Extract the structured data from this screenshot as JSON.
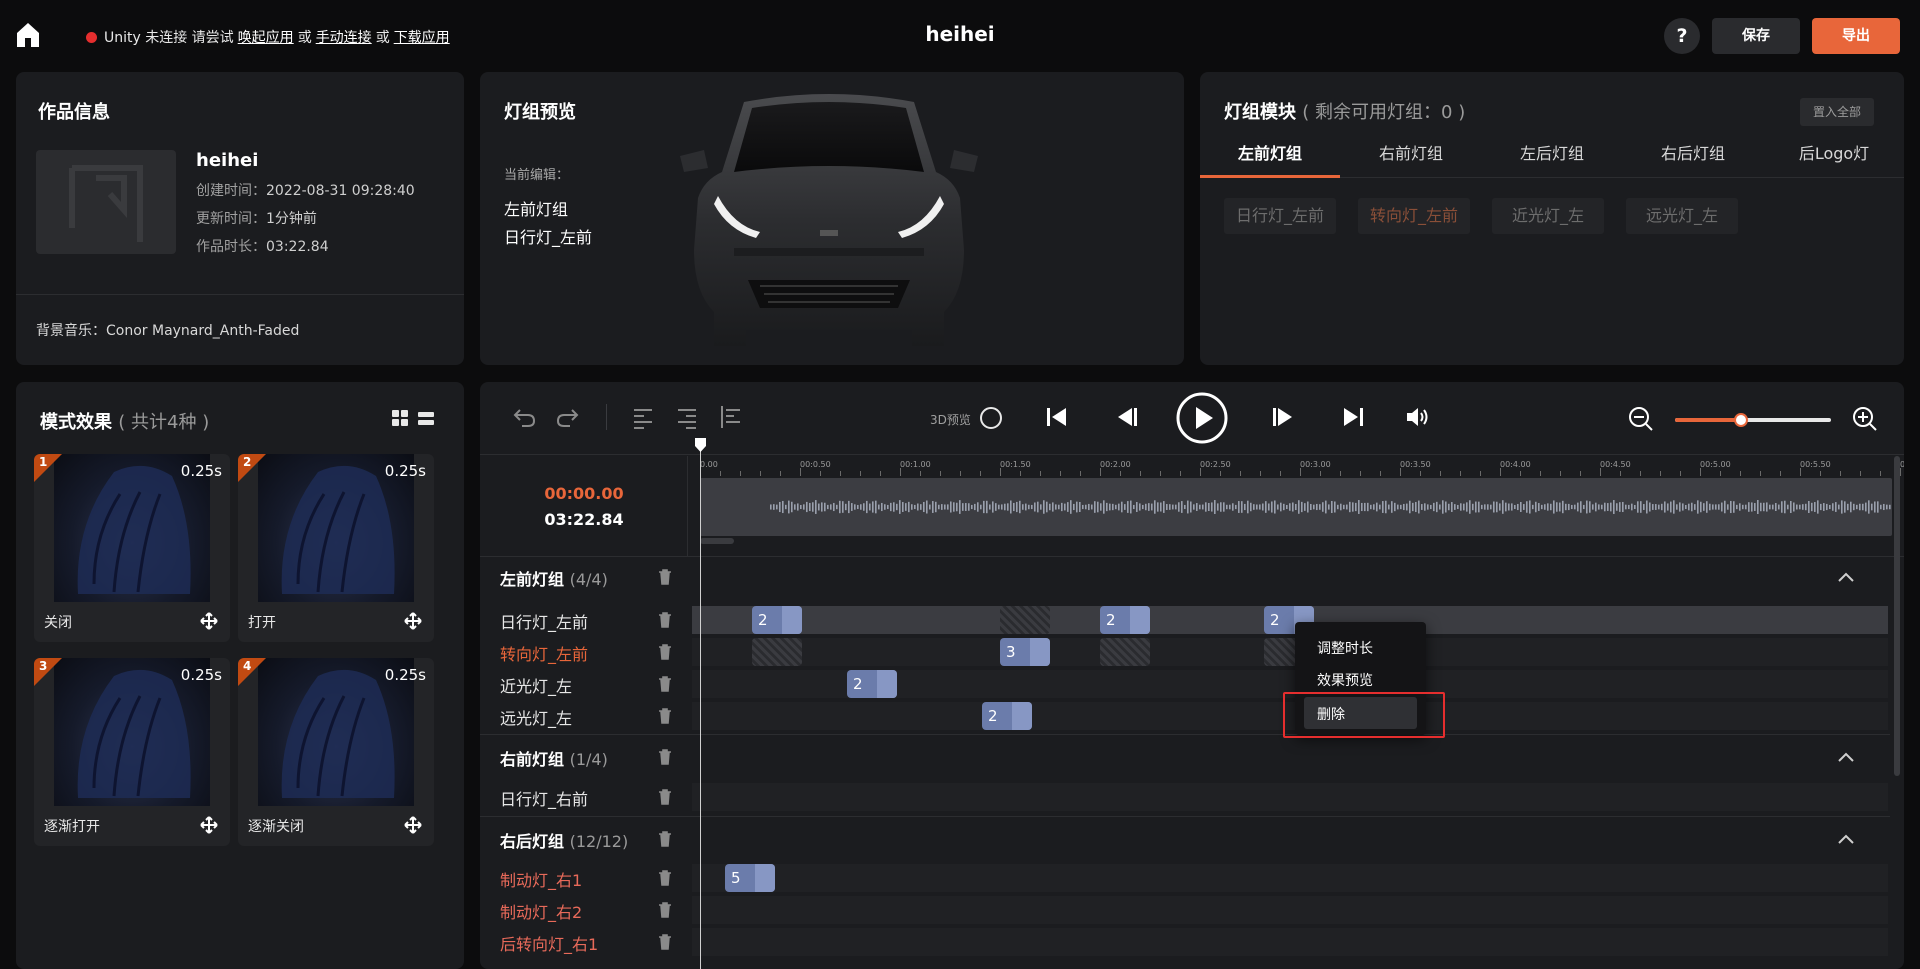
{
  "topbar": {
    "status_prefix": "Unity 未连接 请尝试",
    "link_wake": "唤起应用",
    "or1": "或",
    "link_manual": "手动连接",
    "or2": "或",
    "link_download": "下载应用",
    "title": "heihei",
    "help": "?",
    "save": "保存",
    "export": "导出",
    "status_color": "#e52e2e",
    "accent": "#e8663a"
  },
  "info": {
    "title": "作品信息",
    "name": "heihei",
    "created_label": "创建时间：",
    "created": "2022-08-31 09:28:40",
    "updated_label": "更新时间：",
    "updated": "1分钟前",
    "duration_label": "作品时长：",
    "duration": "03:22.84",
    "music_label": "背景音乐：",
    "music": "Conor Maynard_Anth-Faded"
  },
  "preview": {
    "title": "灯组预览",
    "editing_label": "当前编辑：",
    "group": "左前灯组",
    "light": "日行灯_左前"
  },
  "modules": {
    "title": "灯组模块",
    "remaining": "( 剩余可用灯组：0 )",
    "put_all": "置入全部",
    "tabs": [
      {
        "label": "左前灯组",
        "active": true
      },
      {
        "label": "右前灯组"
      },
      {
        "label": "左后灯组"
      },
      {
        "label": "右后灯组"
      },
      {
        "label": "后Logo灯"
      }
    ],
    "chips": [
      "日行灯_左前",
      "转向灯_左前",
      "近光灯_左",
      "远光灯_左"
    ]
  },
  "patterns": {
    "title": "模式效果",
    "count": "( 共计4种 )",
    "items": [
      {
        "num": "1",
        "duration": "0.25s",
        "label": "关闭"
      },
      {
        "num": "2",
        "duration": "0.25s",
        "label": "打开"
      },
      {
        "num": "3",
        "duration": "0.25s",
        "label": "逐渐打开"
      },
      {
        "num": "4",
        "duration": "0.25s",
        "label": "逐渐关闭"
      }
    ]
  },
  "timeline": {
    "label_3d": "3D预览",
    "current_time": "00:00.00",
    "total_time": "03:22.84",
    "zoom_level": 0.42,
    "ruler": [
      "0.00",
      "00:0.50",
      "00:1.00",
      "00:1.50",
      "00:2.00",
      "00:2.50",
      "00:3.00",
      "00:3.50",
      "00:4.00",
      "00:4.50",
      "00:5.00",
      "00:5.50",
      "0"
    ],
    "groups": [
      {
        "name": "左前灯组",
        "count": "(4/4)",
        "tracks": [
          {
            "name": "日行灯_左前",
            "color": "#e8e8e8",
            "clips": [
              "2",
              "2",
              "2"
            ]
          },
          {
            "name": "转向灯_左前",
            "color": "#e8663a",
            "clips": [
              "3"
            ]
          },
          {
            "name": "近光灯_左",
            "color": "#e8e8e8",
            "clips": [
              "2"
            ]
          },
          {
            "name": "远光灯_左",
            "color": "#e8e8e8",
            "clips": [
              "2"
            ]
          }
        ]
      },
      {
        "name": "右前灯组",
        "count": "(1/4)",
        "tracks": [
          {
            "name": "日行灯_右前",
            "color": "#e8e8e8",
            "clips": []
          }
        ]
      },
      {
        "name": "右后灯组",
        "count": "(12/12)",
        "tracks": [
          {
            "name": "制动灯_右1",
            "color": "#e86a5a",
            "clips": [
              "5"
            ]
          },
          {
            "name": "制动灯_右2",
            "color": "#e86a5a",
            "clips": []
          },
          {
            "name": "后转向灯_右1",
            "color": "#e86a5a",
            "clips": []
          }
        ]
      }
    ]
  },
  "context_menu": {
    "items": [
      "调整时长",
      "效果预览",
      "删除"
    ],
    "highlighted": "删除"
  }
}
